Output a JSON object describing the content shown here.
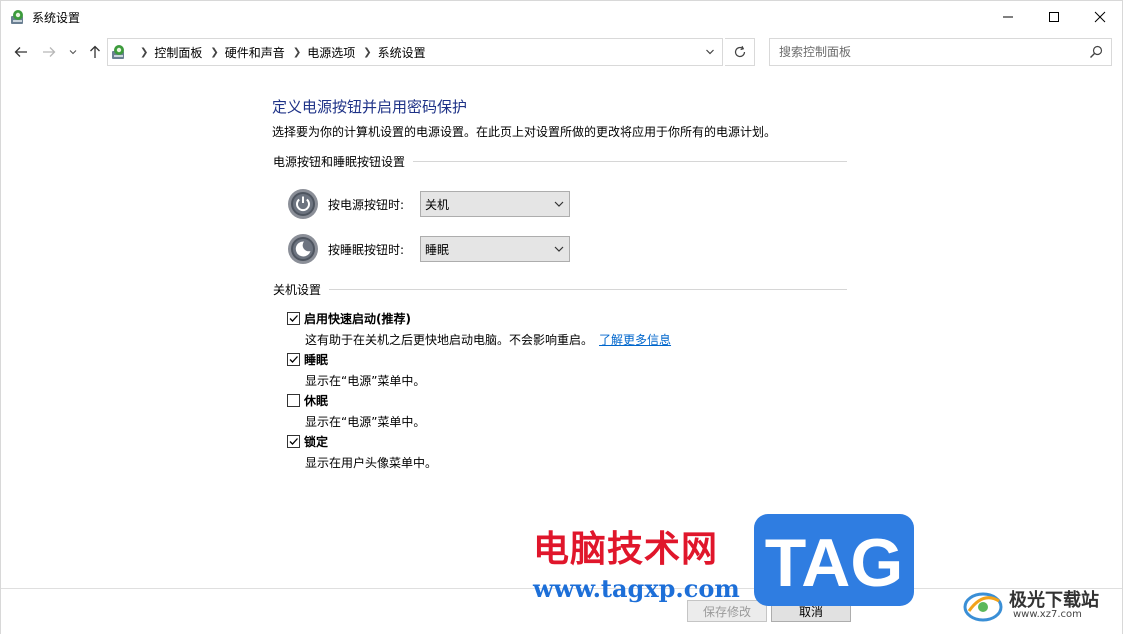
{
  "window": {
    "title": "系统设置"
  },
  "address": {
    "crumbs": [
      "控制面板",
      "硬件和声音",
      "电源选项",
      "系统设置"
    ]
  },
  "search": {
    "placeholder": "搜索控制面板"
  },
  "page": {
    "title": "定义电源按钮并启用密码保护",
    "description": "选择要为你的计算机设置的电源设置。在此页上对设置所做的更改将应用于你所有的电源计划。"
  },
  "power_section": {
    "header": "电源按钮和睡眠按钮设置",
    "power_button": {
      "label": "按电源按钮时:",
      "value": "关机"
    },
    "sleep_button": {
      "label": "按睡眠按钮时:",
      "value": "睡眠"
    }
  },
  "shutdown_section": {
    "header": "关机设置",
    "items": [
      {
        "label": "启用快速启动(推荐)",
        "checked": true,
        "desc": "这有助于在关机之后更快地启动电脑。不会影响重启。",
        "link": "了解更多信息"
      },
      {
        "label": "睡眠",
        "checked": true,
        "desc": "显示在“电源”菜单中。"
      },
      {
        "label": "休眠",
        "checked": false,
        "desc": "显示在“电源”菜单中。"
      },
      {
        "label": "锁定",
        "checked": true,
        "desc": "显示在用户头像菜单中。"
      }
    ]
  },
  "buttons": {
    "save": "保存修改",
    "cancel": "取消"
  },
  "watermark": {
    "site_name": "电脑技术网",
    "url": "www.tagxp.com",
    "tag": "TAG",
    "logo_text": "极光下载站",
    "logo_url": "www.xz7.com"
  },
  "colors": {
    "title_blue": "#1e3287",
    "link_blue": "#0066cc",
    "tag_blue": "#2f7de1",
    "wm_red": "#e0162b"
  }
}
